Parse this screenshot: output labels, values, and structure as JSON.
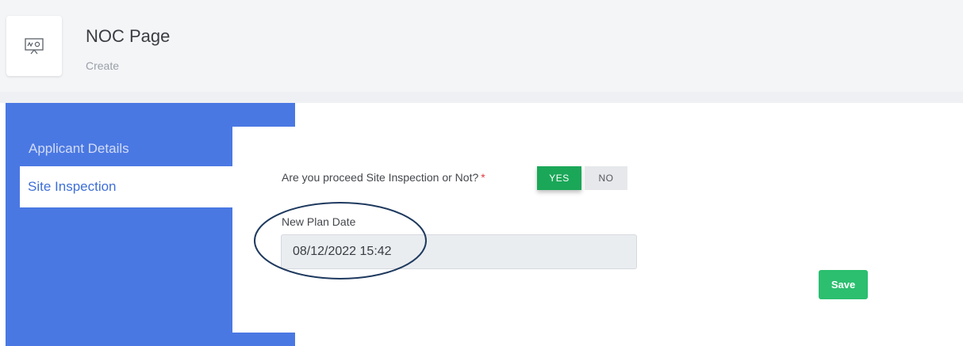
{
  "header": {
    "title": "NOC Page",
    "subtitle": "Create",
    "icon": "presentation-board-icon"
  },
  "sidebar": {
    "items": [
      {
        "label": "Applicant Details",
        "active": false
      },
      {
        "label": "Site Inspection",
        "active": true
      }
    ]
  },
  "form": {
    "question": "Are you proceed Site Inspection or Not?",
    "required_marker": "*",
    "yes_label": "YES",
    "no_label": "NO",
    "selected": "YES",
    "date_label": "New Plan Date",
    "date_value": "08/12/2022 15:42",
    "save_label": "Save"
  },
  "colors": {
    "sidebar": "#4a78e3",
    "active_tab_text": "#3d6fd6",
    "yes_active": "#1aa758",
    "save": "#2bbf6f",
    "annotation": "#1f3a5f"
  }
}
